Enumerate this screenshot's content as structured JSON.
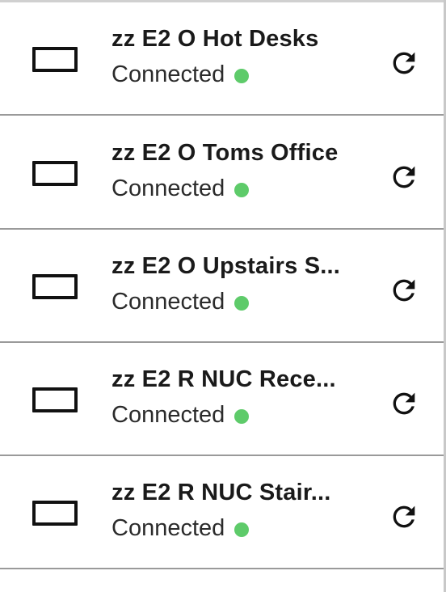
{
  "devices": [
    {
      "name": "zz E2 O Hot Desks",
      "status": "Connected",
      "icon": "display-icon",
      "action_icon": "refresh-icon"
    },
    {
      "name": "zz E2 O Toms Office",
      "status": "Connected",
      "icon": "display-icon",
      "action_icon": "refresh-icon"
    },
    {
      "name": "zz E2 O Upstairs S...",
      "status": "Connected",
      "icon": "display-icon",
      "action_icon": "refresh-icon"
    },
    {
      "name": "zz E2 R NUC Rece...",
      "status": "Connected",
      "icon": "display-icon",
      "action_icon": "refresh-icon"
    },
    {
      "name": "zz E2 R NUC Stair...",
      "status": "Connected",
      "icon": "display-icon",
      "action_icon": "refresh-icon"
    }
  ],
  "colors": {
    "status_connected": "#5ecb6a",
    "text": "#1a1a1a",
    "divider": "#9a9a9a"
  }
}
